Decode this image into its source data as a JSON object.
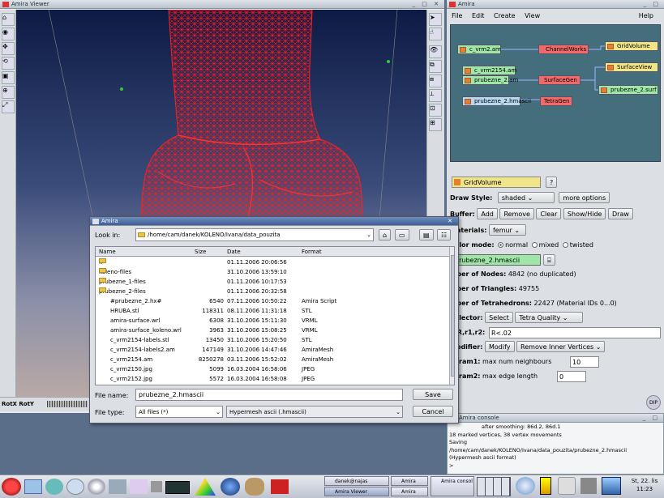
{
  "viewer": {
    "title": "Amira Viewer",
    "bottom_labels": [
      "RotX",
      "RotY"
    ]
  },
  "main": {
    "title": "Amira",
    "menu": [
      "File",
      "Edit",
      "Create",
      "View"
    ],
    "help": "Help",
    "nodes": {
      "c_vrm2_am": "c_vrm2.am",
      "channelworks": "ChannelWorks",
      "gridvolume": "GridVolume",
      "c_vrm2154": "c_vrm2154.am",
      "surfaceview": "SurfaceView",
      "prubezne2_am": "prubezne_2.am",
      "surfacegen": "SurfaceGen",
      "prubezne2_surf": "prubezne_2.surf",
      "prubezne2_hmascii": "prubezne_2.hmascii",
      "tetragen": "TetraGen"
    }
  },
  "props": {
    "module": "GridVolume",
    "help_btn": "?",
    "draw_style_label": "Draw Style:",
    "draw_style_value": "shaded",
    "more_options": "more options",
    "buffer_label": "Buffer:",
    "buffer_btns": [
      "Add",
      "Remove",
      "Clear",
      "Show/Hide",
      "Draw"
    ],
    "materials_label": "Materials:",
    "materials_value": "femur",
    "color_mode_label": "Color mode:",
    "color_modes": [
      "normal",
      "mixed",
      "twisted"
    ],
    "data_field": "prubezne_2.hmascii",
    "nodes_label": "mber of Nodes:",
    "nodes_value": "4842 (no duplicated)",
    "triangles_label": "mber of Triangles:",
    "triangles_value": "49755",
    "tetra_label": "mber of Tetrahedrons:",
    "tetra_value": "22427 (Material IDs 0...0)",
    "selector_label": "Selector:",
    "select_btn": "Select",
    "tetra_quality": "Tetra Quality",
    "drr_label": "d,R,r1,r2:",
    "drr_value": "R<.02",
    "modifier_label": "Modifier:",
    "modify_btn": "Modify",
    "remove_inner": "Remove Inner Vertices",
    "param1_label": "Param1:",
    "param1_text": "max num neighbours",
    "param1_value": "10",
    "param2_label": "Param2:",
    "param2_text": "max edge length",
    "param2_value": "0"
  },
  "console": {
    "title": "Amira console",
    "lines": [
      "after smoothing: 86d.2, 86d.1",
      "18 marked vertices, 38 vertex movements",
      "Saving",
      "/home/cam/danek/KOLENO/Ivana/data_pouzita/prubezne_2.hmascii",
      "(Hypermesh ascii format)",
      ">"
    ]
  },
  "dialog": {
    "title": "Amira",
    "look_in_label": "Look in:",
    "look_in_value": "/home/cam/danek/KOLENO/Ivana/data_pouzita",
    "columns": [
      "Name",
      "Size",
      "Date",
      "Format"
    ],
    "files": [
      {
        "name": "..",
        "size": "",
        "date": "01.11.2006 20:06:56",
        "format": "",
        "folder": true
      },
      {
        "name": "koleno-files",
        "size": "",
        "date": "31.10.2006 13:59:10",
        "format": "",
        "folder": true
      },
      {
        "name": "prubezne_1-files",
        "size": "",
        "date": "01.11.2006 10:17:53",
        "format": "",
        "folder": true
      },
      {
        "name": "prubezne_2-files",
        "size": "",
        "date": "01.11.2006 20:32:58",
        "format": "",
        "folder": true
      },
      {
        "name": "#prubezne_2.hx#",
        "size": "6540",
        "date": "07.11.2006 10:50:22",
        "format": "Amira Script",
        "folder": false
      },
      {
        "name": "HRUBA.stl",
        "size": "118311",
        "date": "08.11.2006 11:31:18",
        "format": "STL",
        "folder": false
      },
      {
        "name": "amira-surface.wrl",
        "size": "6308",
        "date": "31.10.2006 15:11:30",
        "format": "VRML",
        "folder": false
      },
      {
        "name": "amira-surface_koleno.wrl",
        "size": "3963",
        "date": "31.10.2006 15:08:25",
        "format": "VRML",
        "folder": false
      },
      {
        "name": "c_vrm2154-labels.stl",
        "size": "13450",
        "date": "31.10.2006 15:20:50",
        "format": "STL",
        "folder": false
      },
      {
        "name": "c_vrm2154-labels2.am",
        "size": "147149",
        "date": "31.10.2006 14:47:46",
        "format": "AmiraMesh",
        "folder": false
      },
      {
        "name": "c_vrm2154.am",
        "size": "8250278",
        "date": "03.11.2006 15:52:02",
        "format": "AmiraMesh",
        "folder": false
      },
      {
        "name": "c_vrm2150.jpg",
        "size": "5099",
        "date": "16.03.2004 16:58:06",
        "format": "JPEG",
        "folder": false
      },
      {
        "name": "c_vrm2152.jpg",
        "size": "5572",
        "date": "16.03.2004 16:58:08",
        "format": "JPEG",
        "folder": false
      }
    ],
    "file_name_label": "File name:",
    "file_name_value": "prubezne_2.hmascii",
    "save_btn": "Save",
    "file_type_label": "File type:",
    "file_type_value": "All files (*)",
    "format_value": "Hypermesh ascii (.hmascii)",
    "cancel_btn": "Cancel"
  },
  "taskbar": {
    "tasks": [
      {
        "label": "danek@najas",
        "id": "task-terminal"
      },
      {
        "label": "Amira",
        "id": "task-amira"
      },
      {
        "label": "Amira Viewer",
        "id": "task-amira-viewer"
      },
      {
        "label": "Amira",
        "id": "task-amira-2"
      },
      {
        "label": "Amira consol",
        "id": "task-amira-console"
      }
    ],
    "clock_day": "St, 22. lis",
    "clock_time": "11:23"
  }
}
